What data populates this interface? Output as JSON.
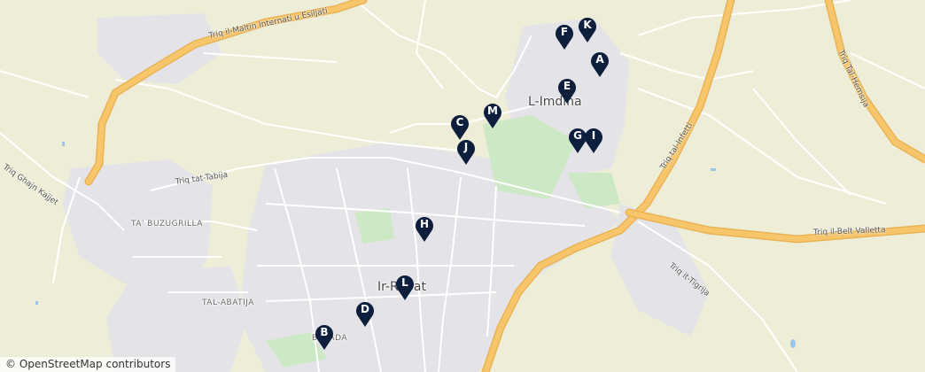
{
  "map": {
    "colors": {
      "land": "#eeeed8",
      "urban": "#e4e4e8",
      "road": "#ffffff",
      "major_road": "#f7c66b",
      "park": "#cde8c4",
      "marker": "#0d1f3c"
    }
  },
  "places": {
    "imdina": "L-Imdina",
    "rabat": "Ir-Rabat",
    "ta_buzugrilla": "TA' BUZUGRILLA",
    "tal_abatija": "TAL-ABATIJA",
    "bajjada": "BAJJADA"
  },
  "streets": {
    "maltin": "Triq il-Maltin Internati u Esiljati",
    "ghajn_kajjet": "Triq Ghajn Kajjet",
    "tat_tabija": "Triq tat-Tabija",
    "tal_infetti": "Triq tal-Infetti",
    "tal_hemsija": "Triq Tal-Hemsija",
    "belt_valletta": "Triq il-Belt Valletta",
    "it_tigrija": "Triq it-Tigrija"
  },
  "markers": [
    "A",
    "B",
    "C",
    "D",
    "E",
    "F",
    "G",
    "H",
    "I",
    "J",
    "K",
    "L",
    "M"
  ],
  "attribution": "© OpenStreetMap contributors"
}
